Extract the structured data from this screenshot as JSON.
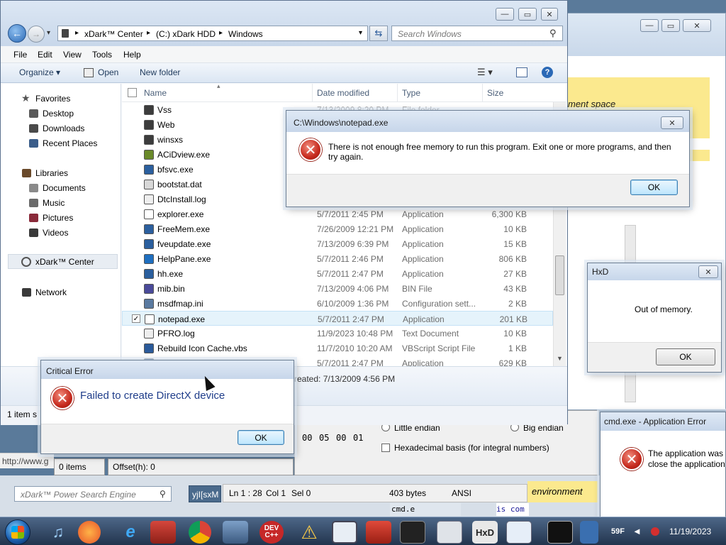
{
  "explorer": {
    "breadcrumb": [
      "xDark™ Center",
      "(C:) xDark HDD",
      "Windows"
    ],
    "search_placeholder": "Search Windows",
    "menu": [
      "File",
      "Edit",
      "View",
      "Tools",
      "Help"
    ],
    "toolbar": {
      "organize": "Organize",
      "open": "Open",
      "new_folder": "New folder"
    },
    "columns": {
      "name": "Name",
      "date": "Date modified",
      "type": "Type",
      "size": "Size"
    },
    "nav": {
      "favorites": "Favorites",
      "desktop": "Desktop",
      "downloads": "Downloads",
      "recent": "Recent Places",
      "libraries": "Libraries",
      "documents": "Documents",
      "music": "Music",
      "pictures": "Pictures",
      "videos": "Videos",
      "xdark": "xDark™ Center",
      "network": "Network"
    },
    "files": [
      {
        "name": "Vss",
        "date": "7/13/2009 8:20 PM",
        "type": "File folder",
        "size": ""
      },
      {
        "name": "Web",
        "date": "",
        "type": "",
        "size": ""
      },
      {
        "name": "winsxs",
        "date": "",
        "type": "",
        "size": ""
      },
      {
        "name": "ACiDview.exe",
        "date": "",
        "type": "",
        "size": ""
      },
      {
        "name": "bfsvc.exe",
        "date": "",
        "type": "",
        "size": ""
      },
      {
        "name": "bootstat.dat",
        "date": "",
        "type": "",
        "size": ""
      },
      {
        "name": "DtcInstall.log",
        "date": "",
        "type": "",
        "size": ""
      },
      {
        "name": "explorer.exe",
        "date": "5/7/2011 2:45 PM",
        "type": "Application",
        "size": "6,300 KB"
      },
      {
        "name": "FreeMem.exe",
        "date": "7/26/2009 12:21 PM",
        "type": "Application",
        "size": "10 KB"
      },
      {
        "name": "fveupdate.exe",
        "date": "7/13/2009 6:39 PM",
        "type": "Application",
        "size": "15 KB"
      },
      {
        "name": "HelpPane.exe",
        "date": "5/7/2011 2:46 PM",
        "type": "Application",
        "size": "806 KB"
      },
      {
        "name": "hh.exe",
        "date": "5/7/2011 2:47 PM",
        "type": "Application",
        "size": "27 KB"
      },
      {
        "name": "mib.bin",
        "date": "7/13/2009 4:06 PM",
        "type": "BIN File",
        "size": "43 KB"
      },
      {
        "name": "msdfmap.ini",
        "date": "6/10/2009 1:36 PM",
        "type": "Configuration sett...",
        "size": "2 KB"
      },
      {
        "name": "notepad.exe",
        "date": "5/7/2011 2:47 PM",
        "type": "Application",
        "size": "201 KB"
      },
      {
        "name": "PFRO.log",
        "date": "11/9/2023 10:48 PM",
        "type": "Text Document",
        "size": "10 KB"
      },
      {
        "name": "Rebuild Icon Cache.vbs",
        "date": "11/7/2010 10:20 AM",
        "type": "VBScript Script File",
        "size": "1 KB"
      },
      {
        "name": "",
        "date": "5/7/2011 2:47 PM",
        "type": "Application",
        "size": "629 KB"
      }
    ],
    "details_created": "reated:  7/13/2009 4:56 PM",
    "status_left": "1 item s"
  },
  "notepad_error": {
    "title": "C:\\Windows\\notepad.exe",
    "message": "There is not enough free memory to run this program. Exit one or more programs, and then try again.",
    "ok": "OK"
  },
  "hxd_error": {
    "title": "HxD",
    "message": "Out of memory.",
    "ok": "OK"
  },
  "critical_error": {
    "title": "Critical Error",
    "message": "Failed to create DirectX device",
    "ok": "OK"
  },
  "cmd_error": {
    "title": "cmd.exe - Application Error",
    "message_line1": "The application was u",
    "message_line2": "close the application"
  },
  "background": {
    "note_text": "ment space",
    "endian_little": "Little endian",
    "endian_big": "Big endian",
    "hex_basis": "Hexadecimal basis (for integral numbers)",
    "hex_values": [
      "00",
      "05",
      "00",
      "01"
    ],
    "url_text": "http://www.g",
    "items": "0 items",
    "offset": "Offset(h): 0",
    "ln": "Ln 1 : 28",
    "col": "Col 1",
    "sel": "Sel 0",
    "bytes": "403 bytes",
    "encoding": "ANSI",
    "environment": "environment",
    "power_search": "xDark™ Power Search Engine",
    "sxm": "yjI[sxM",
    "cmd_label": "cmd.e",
    "is_com": "is com"
  },
  "taskbar": {
    "clock_time": "11/19/2023",
    "hex_partial": "59F",
    "icons": [
      "start-orb",
      "music-icon",
      "firefox-icon",
      "ie-icon",
      "app-icon",
      "chrome-icon",
      "tool-icon",
      "devcpp-icon",
      "warning-icon",
      "window-icon",
      "toolbox-icon",
      "pos-icon",
      "notes-icon",
      "hxd-icon",
      "editor-icon",
      "cmd-icon",
      "network-icon"
    ],
    "dev_label": "DEV C++",
    "hxd_label": "HxD"
  }
}
